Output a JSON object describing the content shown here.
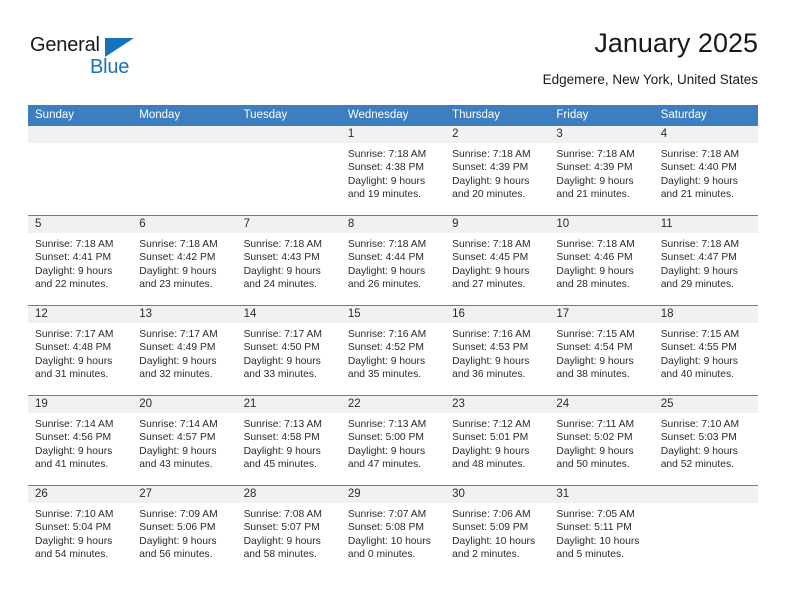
{
  "brand": {
    "name_part1": "General",
    "name_part2": "Blue",
    "accent_color": "#1672bb"
  },
  "header": {
    "title": "January 2025",
    "subtitle": "Edgemere, New York, United States"
  },
  "calendar": {
    "header_bg_color": "#3c7ebf",
    "day_band_color": "#f1f1f1",
    "day_names": [
      "Sunday",
      "Monday",
      "Tuesday",
      "Wednesday",
      "Thursday",
      "Friday",
      "Saturday"
    ],
    "weeks": [
      [
        {
          "empty": true
        },
        {
          "empty": true
        },
        {
          "empty": true
        },
        {
          "day": "1",
          "sunrise": "Sunrise: 7:18 AM",
          "sunset": "Sunset: 4:38 PM",
          "daylight1": "Daylight: 9 hours",
          "daylight2": "and 19 minutes."
        },
        {
          "day": "2",
          "sunrise": "Sunrise: 7:18 AM",
          "sunset": "Sunset: 4:39 PM",
          "daylight1": "Daylight: 9 hours",
          "daylight2": "and 20 minutes."
        },
        {
          "day": "3",
          "sunrise": "Sunrise: 7:18 AM",
          "sunset": "Sunset: 4:39 PM",
          "daylight1": "Daylight: 9 hours",
          "daylight2": "and 21 minutes."
        },
        {
          "day": "4",
          "sunrise": "Sunrise: 7:18 AM",
          "sunset": "Sunset: 4:40 PM",
          "daylight1": "Daylight: 9 hours",
          "daylight2": "and 21 minutes."
        }
      ],
      [
        {
          "day": "5",
          "sunrise": "Sunrise: 7:18 AM",
          "sunset": "Sunset: 4:41 PM",
          "daylight1": "Daylight: 9 hours",
          "daylight2": "and 22 minutes."
        },
        {
          "day": "6",
          "sunrise": "Sunrise: 7:18 AM",
          "sunset": "Sunset: 4:42 PM",
          "daylight1": "Daylight: 9 hours",
          "daylight2": "and 23 minutes."
        },
        {
          "day": "7",
          "sunrise": "Sunrise: 7:18 AM",
          "sunset": "Sunset: 4:43 PM",
          "daylight1": "Daylight: 9 hours",
          "daylight2": "and 24 minutes."
        },
        {
          "day": "8",
          "sunrise": "Sunrise: 7:18 AM",
          "sunset": "Sunset: 4:44 PM",
          "daylight1": "Daylight: 9 hours",
          "daylight2": "and 26 minutes."
        },
        {
          "day": "9",
          "sunrise": "Sunrise: 7:18 AM",
          "sunset": "Sunset: 4:45 PM",
          "daylight1": "Daylight: 9 hours",
          "daylight2": "and 27 minutes."
        },
        {
          "day": "10",
          "sunrise": "Sunrise: 7:18 AM",
          "sunset": "Sunset: 4:46 PM",
          "daylight1": "Daylight: 9 hours",
          "daylight2": "and 28 minutes."
        },
        {
          "day": "11",
          "sunrise": "Sunrise: 7:18 AM",
          "sunset": "Sunset: 4:47 PM",
          "daylight1": "Daylight: 9 hours",
          "daylight2": "and 29 minutes."
        }
      ],
      [
        {
          "day": "12",
          "sunrise": "Sunrise: 7:17 AM",
          "sunset": "Sunset: 4:48 PM",
          "daylight1": "Daylight: 9 hours",
          "daylight2": "and 31 minutes."
        },
        {
          "day": "13",
          "sunrise": "Sunrise: 7:17 AM",
          "sunset": "Sunset: 4:49 PM",
          "daylight1": "Daylight: 9 hours",
          "daylight2": "and 32 minutes."
        },
        {
          "day": "14",
          "sunrise": "Sunrise: 7:17 AM",
          "sunset": "Sunset: 4:50 PM",
          "daylight1": "Daylight: 9 hours",
          "daylight2": "and 33 minutes."
        },
        {
          "day": "15",
          "sunrise": "Sunrise: 7:16 AM",
          "sunset": "Sunset: 4:52 PM",
          "daylight1": "Daylight: 9 hours",
          "daylight2": "and 35 minutes."
        },
        {
          "day": "16",
          "sunrise": "Sunrise: 7:16 AM",
          "sunset": "Sunset: 4:53 PM",
          "daylight1": "Daylight: 9 hours",
          "daylight2": "and 36 minutes."
        },
        {
          "day": "17",
          "sunrise": "Sunrise: 7:15 AM",
          "sunset": "Sunset: 4:54 PM",
          "daylight1": "Daylight: 9 hours",
          "daylight2": "and 38 minutes."
        },
        {
          "day": "18",
          "sunrise": "Sunrise: 7:15 AM",
          "sunset": "Sunset: 4:55 PM",
          "daylight1": "Daylight: 9 hours",
          "daylight2": "and 40 minutes."
        }
      ],
      [
        {
          "day": "19",
          "sunrise": "Sunrise: 7:14 AM",
          "sunset": "Sunset: 4:56 PM",
          "daylight1": "Daylight: 9 hours",
          "daylight2": "and 41 minutes."
        },
        {
          "day": "20",
          "sunrise": "Sunrise: 7:14 AM",
          "sunset": "Sunset: 4:57 PM",
          "daylight1": "Daylight: 9 hours",
          "daylight2": "and 43 minutes."
        },
        {
          "day": "21",
          "sunrise": "Sunrise: 7:13 AM",
          "sunset": "Sunset: 4:58 PM",
          "daylight1": "Daylight: 9 hours",
          "daylight2": "and 45 minutes."
        },
        {
          "day": "22",
          "sunrise": "Sunrise: 7:13 AM",
          "sunset": "Sunset: 5:00 PM",
          "daylight1": "Daylight: 9 hours",
          "daylight2": "and 47 minutes."
        },
        {
          "day": "23",
          "sunrise": "Sunrise: 7:12 AM",
          "sunset": "Sunset: 5:01 PM",
          "daylight1": "Daylight: 9 hours",
          "daylight2": "and 48 minutes."
        },
        {
          "day": "24",
          "sunrise": "Sunrise: 7:11 AM",
          "sunset": "Sunset: 5:02 PM",
          "daylight1": "Daylight: 9 hours",
          "daylight2": "and 50 minutes."
        },
        {
          "day": "25",
          "sunrise": "Sunrise: 7:10 AM",
          "sunset": "Sunset: 5:03 PM",
          "daylight1": "Daylight: 9 hours",
          "daylight2": "and 52 minutes."
        }
      ],
      [
        {
          "day": "26",
          "sunrise": "Sunrise: 7:10 AM",
          "sunset": "Sunset: 5:04 PM",
          "daylight1": "Daylight: 9 hours",
          "daylight2": "and 54 minutes."
        },
        {
          "day": "27",
          "sunrise": "Sunrise: 7:09 AM",
          "sunset": "Sunset: 5:06 PM",
          "daylight1": "Daylight: 9 hours",
          "daylight2": "and 56 minutes."
        },
        {
          "day": "28",
          "sunrise": "Sunrise: 7:08 AM",
          "sunset": "Sunset: 5:07 PM",
          "daylight1": "Daylight: 9 hours",
          "daylight2": "and 58 minutes."
        },
        {
          "day": "29",
          "sunrise": "Sunrise: 7:07 AM",
          "sunset": "Sunset: 5:08 PM",
          "daylight1": "Daylight: 10 hours",
          "daylight2": "and 0 minutes."
        },
        {
          "day": "30",
          "sunrise": "Sunrise: 7:06 AM",
          "sunset": "Sunset: 5:09 PM",
          "daylight1": "Daylight: 10 hours",
          "daylight2": "and 2 minutes."
        },
        {
          "day": "31",
          "sunrise": "Sunrise: 7:05 AM",
          "sunset": "Sunset: 5:11 PM",
          "daylight1": "Daylight: 10 hours",
          "daylight2": "and 5 minutes."
        },
        {
          "empty": true
        }
      ]
    ]
  }
}
